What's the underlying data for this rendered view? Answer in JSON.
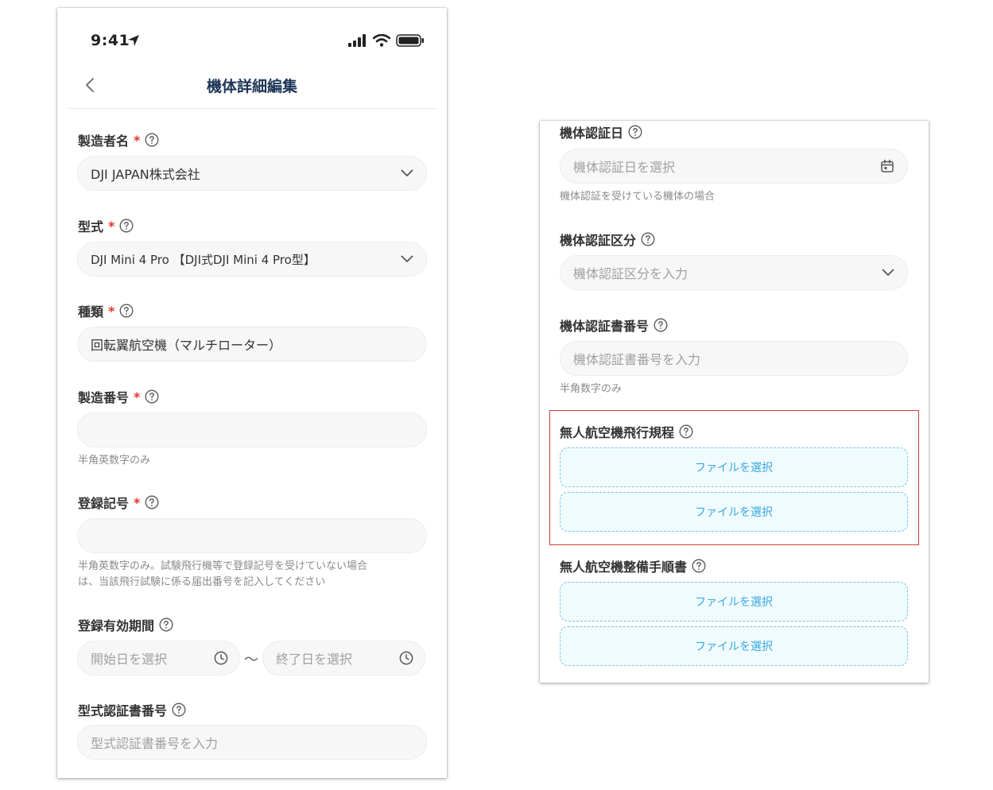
{
  "phone": {
    "status": {
      "time": "9:41"
    },
    "nav": {
      "title": "機体詳細編集"
    },
    "manufacturer": {
      "label": "製造者名",
      "required": "*",
      "value": "DJI JAPAN株式会社"
    },
    "model": {
      "label": "型式",
      "required": "*",
      "value": "DJI Mini 4 Pro 【DJI式DJI Mini 4 Pro型】"
    },
    "type": {
      "label": "種類",
      "required": "*",
      "value": "回転翼航空機（マルチローター）"
    },
    "serial": {
      "label": "製造番号",
      "required": "*",
      "value": "",
      "hint": "半角英数字のみ"
    },
    "registration": {
      "label": "登録記号",
      "required": "*",
      "value": "",
      "hint_line1": "半角英数字のみ。試験飛行機等で登録記号を受けていない場合",
      "hint_line2": "は、当該飛行試験に係る届出番号を記入してください"
    },
    "validity": {
      "label": "登録有効期間",
      "start_placeholder": "開始日を選択",
      "separator": "〜",
      "end_placeholder": "終了日を選択"
    },
    "type_cert": {
      "label": "型式認証書番号",
      "placeholder": "型式認証書番号を入力"
    }
  },
  "detail": {
    "cert_date": {
      "label": "機体認証日",
      "placeholder": "機体認証日を選択",
      "hint": "機体認証を受けている機体の場合"
    },
    "cert_class": {
      "label": "機体認証区分",
      "placeholder": "機体認証区分を入力"
    },
    "cert_number": {
      "label": "機体認証書番号",
      "placeholder": "機体認証書番号を入力",
      "hint": "半角数字のみ"
    },
    "flight_rules": {
      "label": "無人航空機飛行規程",
      "buttons": [
        "ファイルを選択",
        "ファイルを選択"
      ]
    },
    "maintenance": {
      "label": "無人航空機整備手順書",
      "buttons": [
        "ファイルを選択",
        "ファイルを選択"
      ]
    }
  },
  "colors": {
    "accent": "#3aa8dd",
    "required": "#e0352b",
    "highlight": "#c9403b",
    "title": "#1d3557"
  }
}
